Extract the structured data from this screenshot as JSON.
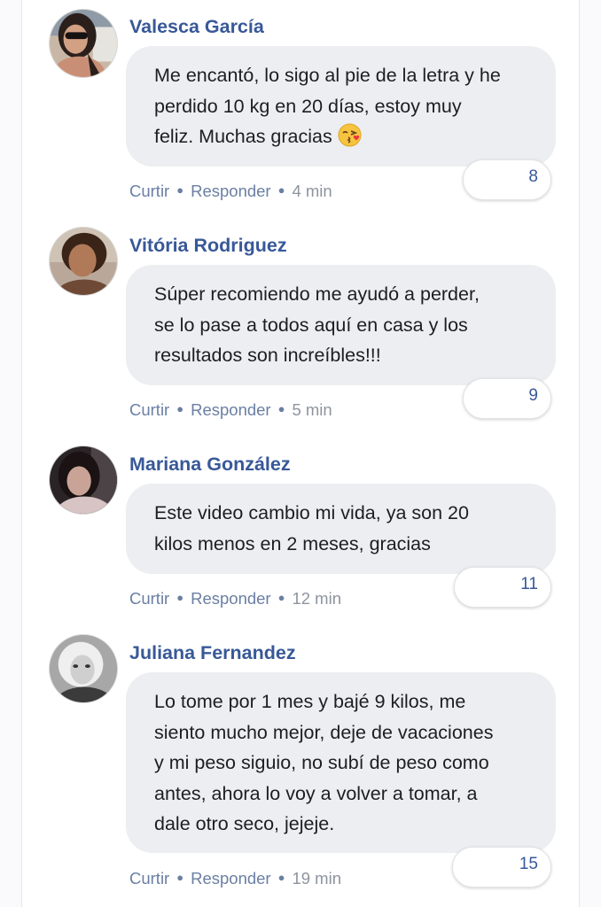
{
  "comments": [
    {
      "author": "Valesca García",
      "lines": [
        "Me encantó, lo sigo al pie de la letra y he",
        "perdido 10 kg en 20 días, estoy muy",
        "feliz. Muchas gracias"
      ],
      "emoji": "kissing-face-emoji",
      "reactions": "8",
      "like": "Curtir",
      "reply": "Responder",
      "time": "4 min"
    },
    {
      "author": "Vitória Rodriguez",
      "lines": [
        "Súper recomiendo me ayudó a perder,",
        "se lo pase a todos aquí en casa y los",
        "resultados son increíbles!!!"
      ],
      "reactions": "9",
      "like": "Curtir",
      "reply": "Responder",
      "time": "5 min"
    },
    {
      "author": "Mariana González",
      "lines": [
        "Este video cambio mi vida, ya son 20",
        "kilos menos en 2 meses, gracias"
      ],
      "reactions": "11",
      "like": "Curtir",
      "reply": "Responder",
      "time": "12 min"
    },
    {
      "author": "Juliana Fernandez",
      "lines": [
        "Lo tome por 1 mes y bajé 9 kilos, me",
        "siento mucho mejor, deje de vacaciones",
        "y mi peso siguio, no subí de peso como",
        "antes, ahora lo voy a volver a tomar, a",
        "dale otro seco, jejeje."
      ],
      "reactions": "15",
      "like": "Curtir",
      "reply": "Responder",
      "time": "19 min"
    }
  ],
  "colors": {
    "name": "#385898",
    "bubble": "#eceef1",
    "action": "#6a7fa3",
    "time": "#8d949e"
  }
}
